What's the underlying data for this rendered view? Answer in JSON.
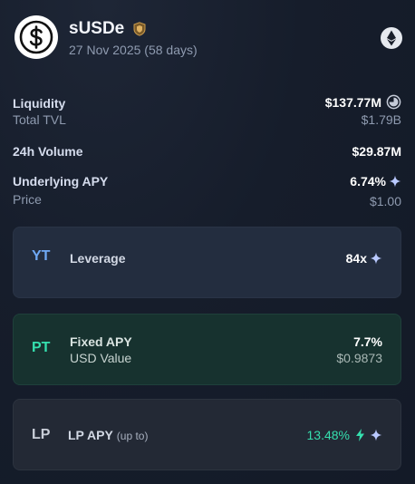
{
  "asset": {
    "name": "sUSDe",
    "maturity": "27 Nov 2025 (58 days)"
  },
  "stats": {
    "liquidity_label": "Liquidity",
    "liquidity_value": "$137.77M",
    "liquidity_fill_fraction": 0.75,
    "tvl_label": "Total TVL",
    "tvl_value": "$1.79B",
    "volume_label": "24h Volume",
    "volume_value": "$29.87M",
    "apy_label": "Underlying APY",
    "apy_value": "6.74%",
    "price_label": "Price",
    "price_value": "$1.00"
  },
  "yt": {
    "badge": "YT",
    "label": "Leverage",
    "value": "84x"
  },
  "pt": {
    "badge": "PT",
    "label": "Fixed APY",
    "value": "7.7%",
    "sub_label": "USD Value",
    "sub_value": "$0.9873"
  },
  "lp": {
    "badge": "LP",
    "label": "LP APY",
    "tag": "(up to)",
    "value": "13.48%"
  },
  "colors": {
    "yt_accent": "#6fa8f4",
    "pt_accent": "#35dfae",
    "lp_value": "#35dfae",
    "background": "#141b2a"
  },
  "icons": {
    "logo": "dollar-coin-icon",
    "verified": "shield-badge-icon",
    "chain": "ethereum-icon",
    "liquidity": "pie-chart-icon",
    "boost": "sparkle-icon",
    "lightning": "bolt-icon"
  }
}
